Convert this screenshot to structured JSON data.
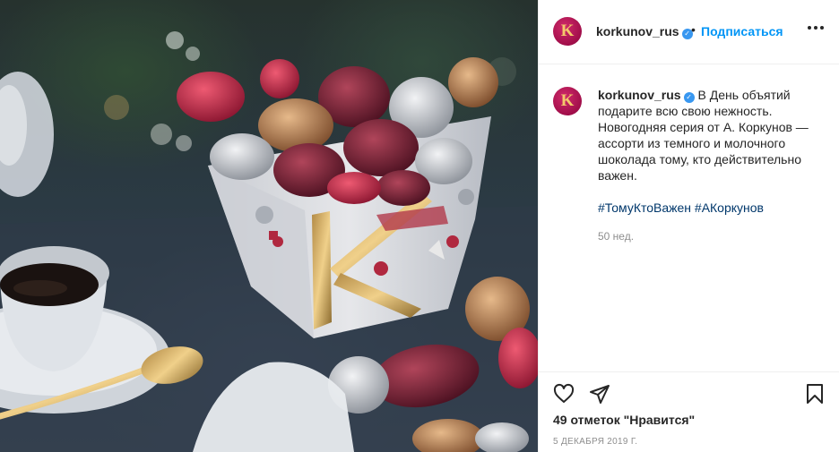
{
  "post": {
    "author": {
      "username": "korkunov_rus",
      "avatar_letter": "K",
      "verified": true
    },
    "follow_label": "Подписаться",
    "separator": "•",
    "caption": {
      "text": "В День объятий подарите всю свою нежность. Новогодняя серия от А. Коркунов — ассорти из темного и молочного шоколада тому, кто действительно важен.",
      "hashtags": [
        "#ТомуКтоВажен",
        "#АКоркунов"
      ],
      "age": "50 нед."
    },
    "likes_text": "49 отметок \"Нравится\"",
    "date_text": "5 ДЕКАБРЯ 2019 Г.",
    "icons": {
      "more": "more-options-icon",
      "like": "heart-icon",
      "share": "send-icon",
      "save": "bookmark-icon",
      "verified": "verified-badge-icon"
    },
    "colors": {
      "accent": "#0095f6",
      "hashtag": "#00376b",
      "verified": "#3897f0",
      "brand": "#a10e4a"
    }
  }
}
